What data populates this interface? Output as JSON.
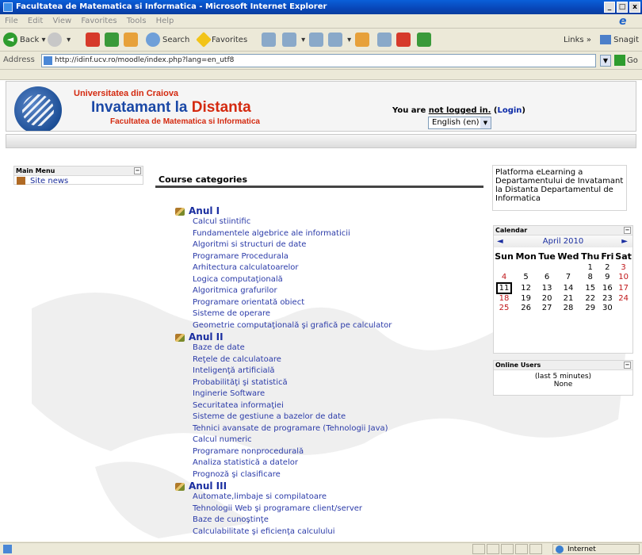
{
  "window": {
    "title": "Facultatea de Matematica si Informatica - Microsoft Internet Explorer",
    "buttons": [
      "_",
      "□",
      "x"
    ]
  },
  "menu": [
    "File",
    "Edit",
    "View",
    "Favorites",
    "Tools",
    "Help"
  ],
  "toolbar": {
    "back": "Back",
    "search": "Search",
    "favorites": "Favorites",
    "links": "Links",
    "snagit": "Snagit"
  },
  "address": {
    "label": "Address",
    "url": "http://idinf.ucv.ro/moodle/index.php?lang=en_utf8",
    "go": "Go"
  },
  "header": {
    "university": "Universitatea din Craiova",
    "title_part1": "Invatamant la ",
    "title_part2": "Distanta",
    "faculty": "Facultatea de Matematica si Informatica",
    "login_prefix": "You are ",
    "login_status": "not logged in.",
    "login_open": " (",
    "login_link": "Login",
    "login_close": ")",
    "language": "English (en)"
  },
  "main_menu": {
    "title": "Main Menu",
    "items": [
      {
        "label": "Site news"
      }
    ]
  },
  "course_categories": {
    "title": "Course categories",
    "years": [
      {
        "name": "Anul I",
        "courses": [
          "Calcul stiintific",
          "Fundamentele algebrice ale informaticii",
          "Algoritmi si structuri de date",
          "Programare Procedurala",
          "Arhitectura calculatoarelor",
          "Logica computaţională",
          "Algoritmica grafurilor",
          "Programare orientată obiect",
          "Sisteme de operare",
          "Geometrie computaţională şi grafică pe calculator"
        ]
      },
      {
        "name": "Anul II",
        "courses": [
          "Baze de date",
          "Reţele de calculatoare",
          "Inteligenţă artificială",
          "Probabilităţi şi statistică",
          "Inginerie Software",
          "Securitatea informaţiei",
          "Sisteme de gestiune a bazelor de date",
          "Tehnici avansate de programare (Tehnologii Java)",
          "Calcul numeric",
          "Programare nonprocedurală",
          "Analiza statistică a datelor",
          "Prognoză şi clasificare"
        ]
      },
      {
        "name": "Anul III",
        "courses": [
          "Automate,limbaje si compilatoare",
          "Tehnologii Web şi programare client/server",
          "Baze de cunoştinţe",
          "Calculabilitate şi eficienţa calculului"
        ]
      }
    ]
  },
  "platform_text": "Platforma eLearning a Departamentului de Invatamant la Distanta Departamentul de Informatica",
  "calendar": {
    "title": "Calendar",
    "month": "April 2010",
    "prev": "◄",
    "next": "►",
    "weekdays": [
      "Sun",
      "Mon",
      "Tue",
      "Wed",
      "Thu",
      "Fri",
      "Sat"
    ],
    "weeks": [
      [
        "",
        "",
        "",
        "",
        "1",
        "2",
        "3"
      ],
      [
        "4",
        "5",
        "6",
        "7",
        "8",
        "9",
        "10"
      ],
      [
        "11",
        "12",
        "13",
        "14",
        "15",
        "16",
        "17"
      ],
      [
        "18",
        "19",
        "20",
        "21",
        "22",
        "23",
        "24"
      ],
      [
        "25",
        "26",
        "27",
        "28",
        "29",
        "30",
        ""
      ]
    ],
    "today": "11"
  },
  "online_users": {
    "title": "Online Users",
    "period": "(last 5 minutes)",
    "value": "None"
  },
  "status": {
    "zone": "Internet"
  }
}
